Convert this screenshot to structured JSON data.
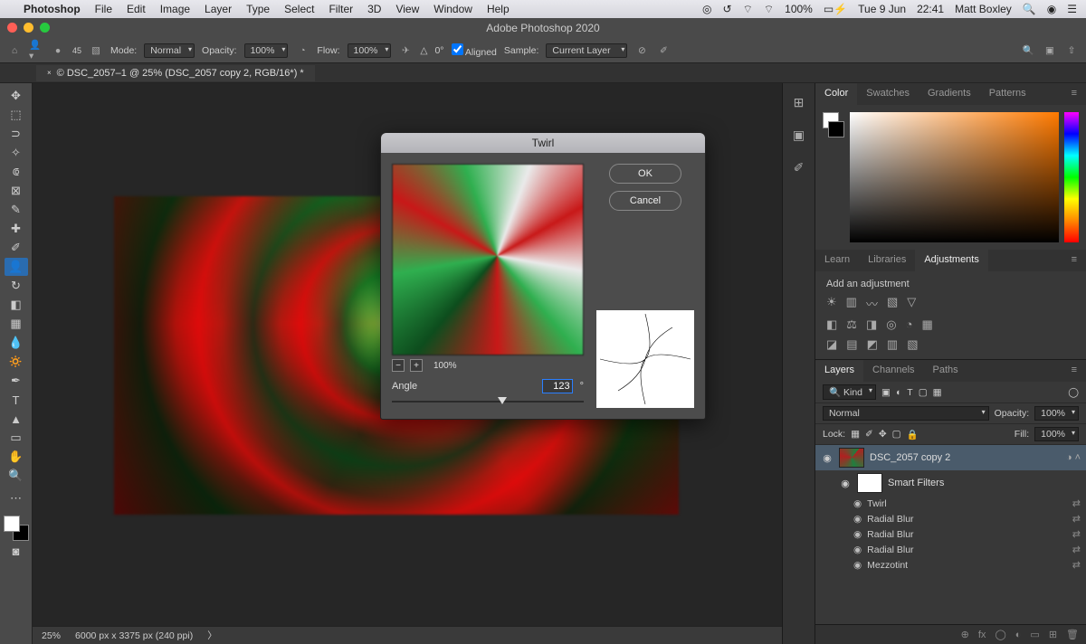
{
  "menubar": {
    "app": "Photoshop",
    "items": [
      "File",
      "Edit",
      "Image",
      "Layer",
      "Type",
      "Select",
      "Filter",
      "3D",
      "View",
      "Window",
      "Help"
    ],
    "battery": "100%",
    "date": "Tue 9 Jun",
    "time": "22:41",
    "user": "Matt Boxley"
  },
  "window": {
    "title": "Adobe Photoshop 2020"
  },
  "options": {
    "mode_label": "Mode:",
    "mode_value": "Normal",
    "opacity_label": "Opacity:",
    "opacity_value": "100%",
    "flow_label": "Flow:",
    "flow_value": "100%",
    "angle_icon": "△",
    "angle_value": "0°",
    "aligned_label": "Aligned",
    "sample_label": "Sample:",
    "sample_value": "Current Layer",
    "brush_size": "45"
  },
  "doc": {
    "tab": "© DSC_2057–1 @ 25% (DSC_2057 copy 2, RGB/16*) *",
    "zoom": "25%",
    "dims": "6000 px x 3375 px (240 ppi)"
  },
  "dialog": {
    "title": "Twirl",
    "ok": "OK",
    "cancel": "Cancel",
    "zoom": "100%",
    "angle_label": "Angle",
    "angle_value": "123",
    "angle_unit": "°",
    "slider_pos_pct": 55
  },
  "panels": {
    "color_tabs": [
      "Color",
      "Swatches",
      "Gradients",
      "Patterns"
    ],
    "learn_tabs": [
      "Learn",
      "Libraries",
      "Adjustments"
    ],
    "adj_hint": "Add an adjustment",
    "layer_tabs": [
      "Layers",
      "Channels",
      "Paths"
    ],
    "kind": "Kind",
    "blend": "Normal",
    "opacity_label": "Opacity:",
    "opacity_value": "100%",
    "lock_label": "Lock:",
    "fill_label": "Fill:",
    "fill_value": "100%",
    "layer_name": "DSC_2057 copy 2",
    "smart_filters": "Smart Filters",
    "filters": [
      "Twirl",
      "Radial Blur",
      "Radial Blur",
      "Radial Blur",
      "Mezzotint"
    ]
  }
}
